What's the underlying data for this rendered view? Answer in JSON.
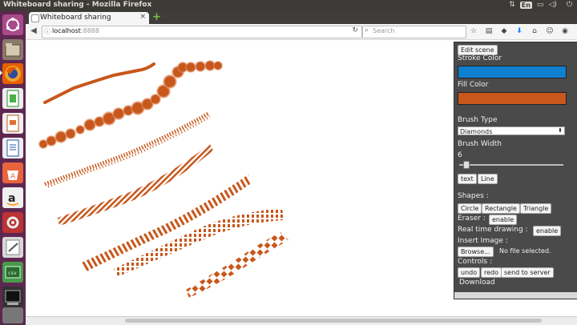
{
  "window": {
    "title": "Whiteboard sharing - Mozilla Firefox"
  },
  "tray": {
    "keyboard": "En",
    "clock": ""
  },
  "tab": {
    "label": "Whiteboard sharing",
    "close": "×"
  },
  "address": {
    "url": "localhost",
    "port": ":8888"
  },
  "search": {
    "placeholder": "Search"
  },
  "panel": {
    "edit_scene": "Edit scene",
    "stroke_color_label": "Stroke Color",
    "stroke_color": "#0f7fcf",
    "fill_color_label": "Fill Color",
    "fill_color": "#c8571b",
    "brush_type_label": "Brush Type",
    "brush_type_value": "Diamonds",
    "brush_width_label": "Brush Width",
    "brush_width_value": "6",
    "text_btn": "text",
    "line_btn": "Line",
    "shapes_label": "Shapes :",
    "circle_btn": "Circle",
    "rectangle_btn": "Rectangle",
    "triangle_btn": "Triangle",
    "eraser_label": "Eraser :",
    "eraser_btn": "enable",
    "realtime_label": "Real time drawing :",
    "realtime_btn": "enable",
    "insert_image_label": "Insert Image :",
    "browse_btn": "Browse...",
    "no_file": "No file selected.",
    "controls_label": "Controls :",
    "undo_btn": "undo",
    "redo_btn": "redo",
    "send_btn": "send to server",
    "download": "Download"
  },
  "colors": {
    "stroke": "#c8571b",
    "accent": "#5e2750"
  },
  "icons": [
    "ubuntu-dash-icon",
    "files-icon",
    "firefox-icon",
    "calc-icon",
    "impress-icon",
    "writer-icon",
    "software-center-icon",
    "amazon-icon",
    "settings-icon",
    "text-editor-icon",
    "terminal-green-icon",
    "terminal-icon",
    "drive-icon"
  ]
}
